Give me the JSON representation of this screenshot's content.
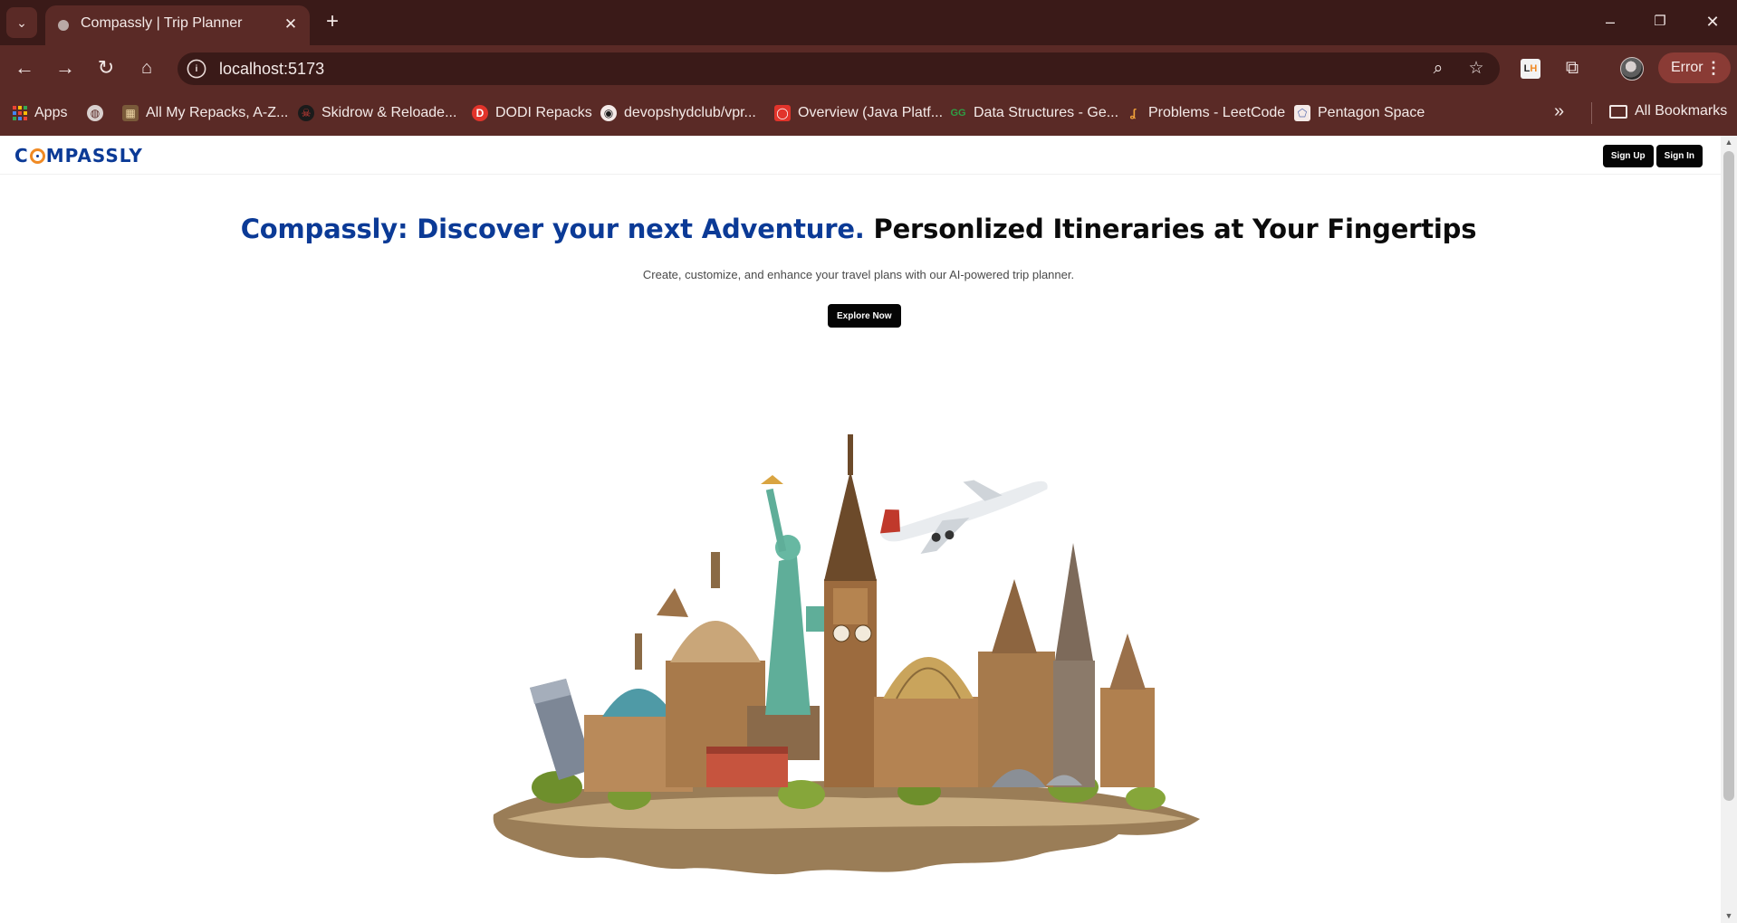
{
  "browser": {
    "tab": {
      "title": "Compassly | Trip Planner"
    },
    "url": "localhost:5173",
    "profile_status": "Error",
    "bookmarks": [
      {
        "label": "Apps",
        "icon": "apps-grid-icon"
      },
      {
        "label": "",
        "icon": "globe-icon"
      },
      {
        "label": "All My Repacks, A-Z...",
        "icon": "repacks-icon"
      },
      {
        "label": "Skidrow & Reloade...",
        "icon": "skull-icon"
      },
      {
        "label": "DODI Repacks",
        "icon": "dodi-icon"
      },
      {
        "label": "devopshydclub/vpr...",
        "icon": "github-icon"
      },
      {
        "label": "Overview (Java Platf...",
        "icon": "oracle-icon"
      },
      {
        "label": "Data Structures - Ge...",
        "icon": "geeksforgeeks-icon"
      },
      {
        "label": "Problems - LeetCode",
        "icon": "leetcode-icon"
      },
      {
        "label": "Pentagon Space",
        "icon": "pentagon-icon"
      }
    ],
    "all_bookmarks_label": "All Bookmarks",
    "lh_badge": {
      "l": "L",
      "h": "H"
    }
  },
  "page": {
    "logo": {
      "before": "C",
      "after": "MPASSLY"
    },
    "nav": {
      "sign_up": "Sign Up",
      "sign_in": "Sign In"
    },
    "hero": {
      "title_blue": "Compassly: Discover your next Adventure.",
      "title_black": "Personlized Itineraries at Your Fingertips",
      "subtitle": "Create, customize, and enhance your travel plans with our AI-powered trip planner.",
      "cta": "Explore Now"
    }
  },
  "colors": {
    "brand_blue": "#0b3a96",
    "browser_frame": "#3a1a18",
    "browser_toolbar": "#5a2a26",
    "button_dark": "#050505"
  }
}
